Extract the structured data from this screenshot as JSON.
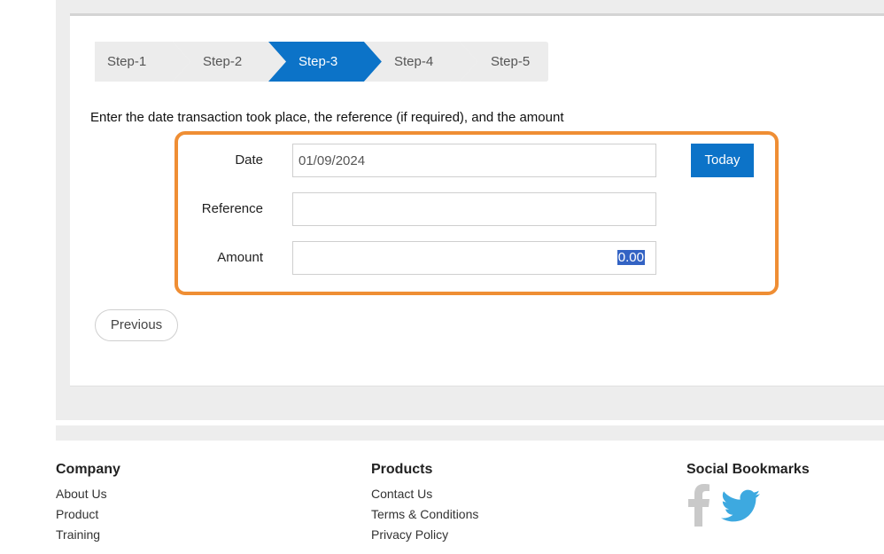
{
  "wizard": {
    "steps": [
      {
        "label": "Step-1",
        "active": false
      },
      {
        "label": "Step-2",
        "active": false
      },
      {
        "label": "Step-3",
        "active": true
      },
      {
        "label": "Step-4",
        "active": false
      },
      {
        "label": "Step-5",
        "active": false
      }
    ],
    "instruction": "Enter the date transaction took place, the reference (if required), and the amount"
  },
  "form": {
    "date_label": "Date",
    "date_value": "01/09/2024",
    "today_label": "Today",
    "reference_label": "Reference",
    "reference_value": "",
    "amount_label": "Amount",
    "amount_value": "0.00",
    "previous_label": "Previous"
  },
  "footer": {
    "company": {
      "title": "Company",
      "links": [
        "About Us",
        "Product",
        "Training"
      ]
    },
    "products": {
      "title": "Products",
      "links": [
        "Contact Us",
        "Terms & Conditions",
        "Privacy Policy"
      ]
    },
    "social": {
      "title": "Social Bookmarks",
      "icons": [
        "facebook-icon",
        "twitter-icon"
      ]
    }
  },
  "colors": {
    "accent": "#0c73c8",
    "highlight": "#ef8e34",
    "step_inactive": "#ececec",
    "social_icon": "#c9c9c9",
    "twitter": "#3da9e0"
  }
}
